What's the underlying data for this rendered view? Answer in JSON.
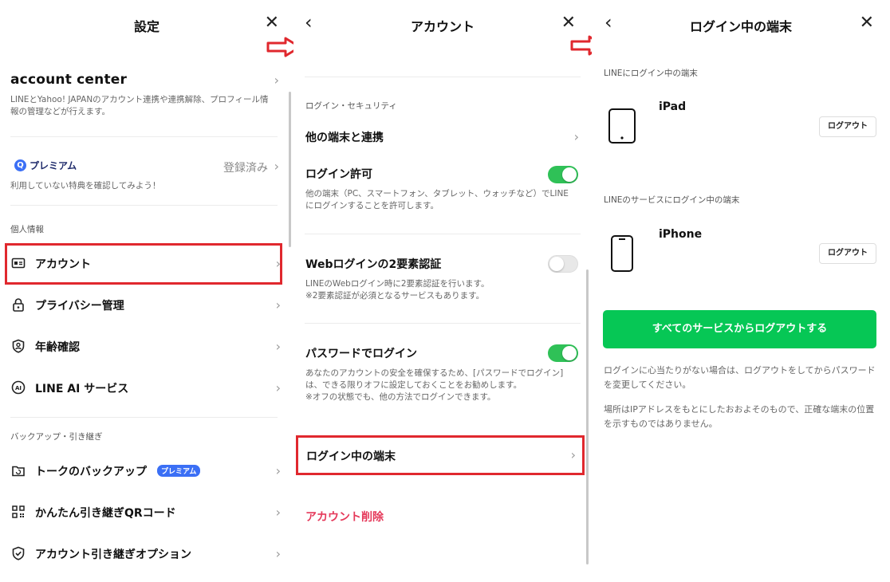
{
  "settings": {
    "title": "設定",
    "account_center": {
      "title": "account center",
      "desc": "LINEとYahoo! JAPANのアカウント連携や連携解除、プロフィール情報の管理などが行えます。"
    },
    "premium": {
      "logo": "プレミアム",
      "status": "登録済み",
      "desc": "利用していない特典を確認してみよう！"
    },
    "personal_section": "個人情報",
    "personal_items": [
      {
        "label": "アカウント"
      },
      {
        "label": "プライバシー管理"
      },
      {
        "label": "年齢確認"
      },
      {
        "label": "LINE AI サービス"
      }
    ],
    "backup_section": "バックアップ・引き継ぎ",
    "backup_items": [
      {
        "label": "トークのバックアップ",
        "badge": "プレミアム"
      },
      {
        "label": "かんたん引き継ぎQRコード"
      },
      {
        "label": "アカウント引き継ぎオプション"
      }
    ]
  },
  "account": {
    "title": "アカウント",
    "section": "ログイン・セキュリティ",
    "link_devices": "他の端末と連携",
    "login_allow": {
      "label": "ログイン許可",
      "desc": "他の端末（PC、スマートフォン、タブレット、ウォッチなど）でLINEにログインすることを許可します。",
      "enabled": true
    },
    "web_2fa": {
      "label": "Webログインの2要素認証",
      "desc1": "LINEのWebログイン時に2要素認証を行います。",
      "desc2": "※2要素認証が必須となるサービスもあります。",
      "enabled": false
    },
    "password_login": {
      "label": "パスワードでログイン",
      "desc1": "あなたのアカウントの安全を確保するため、[パスワードでログイン]は、できる限りオフに設定しておくことをお勧めします。",
      "desc2": "※オフの状態でも、他の方法でログインできます。",
      "enabled": true
    },
    "logged_in_devices": "ログイン中の端末",
    "delete_account": "アカウント削除"
  },
  "devices": {
    "title": "ログイン中の端末",
    "line_section": "LINEにログイン中の端末",
    "line_devices": [
      {
        "name": "iPad",
        "button": "ログアウト"
      }
    ],
    "service_section": "LINEのサービスにログイン中の端末",
    "service_devices": [
      {
        "name": "iPhone",
        "button": "ログアウト"
      }
    ],
    "logout_all": "すべてのサービスからログアウトする",
    "note1": "ログインに心当たりがない場合は、ログアウトをしてからパスワードを変更してください。",
    "note2": "場所はIPアドレスをもとにしたおおよそのもので、正確な端末の位置を示すものではありません。"
  },
  "colors": {
    "accent_green": "#06c755",
    "highlight_red": "#e0282e",
    "danger_text": "#e5395a",
    "premium_badge": "#3b6ff5"
  },
  "icons": {
    "close": "close-icon",
    "back": "back-icon",
    "chevron": "chevron-right-icon",
    "arrow": "red-arrow-icon"
  }
}
